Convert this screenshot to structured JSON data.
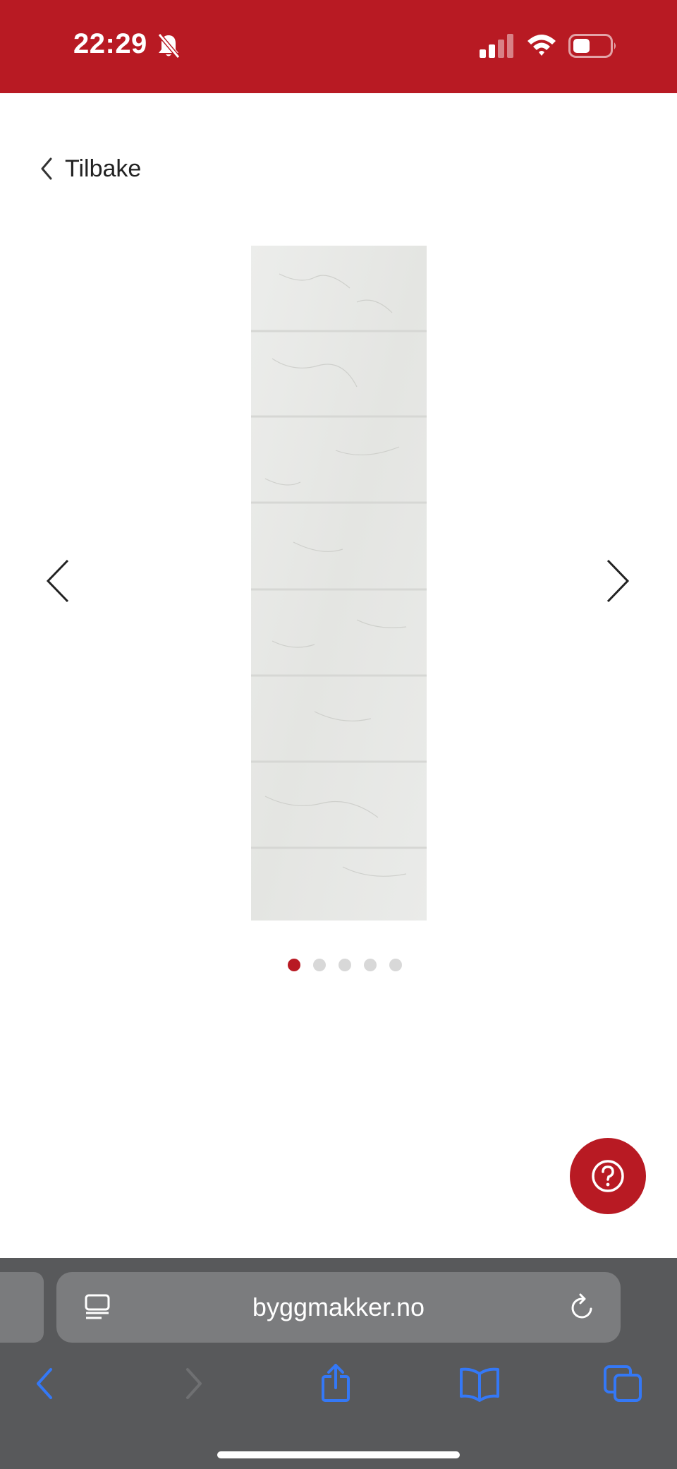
{
  "status_bar": {
    "time": "22:29",
    "background_color": "#b81a23",
    "icons": [
      "bell-slash-icon",
      "cellular-signal-icon",
      "wifi-icon",
      "battery-icon"
    ]
  },
  "page": {
    "back_label": "Tilbake",
    "gallery": {
      "image_count": 5,
      "active_index": 0,
      "active_dot_color": "#b81a23",
      "inactive_dot_color": "#d8d8d8"
    },
    "help_icon": "question-circle-icon"
  },
  "browser": {
    "url": "byggmakker.no",
    "toolbar": [
      "back-icon",
      "forward-icon",
      "share-icon",
      "bookmarks-icon",
      "tabs-icon"
    ],
    "accent_color": "#3478f6"
  }
}
